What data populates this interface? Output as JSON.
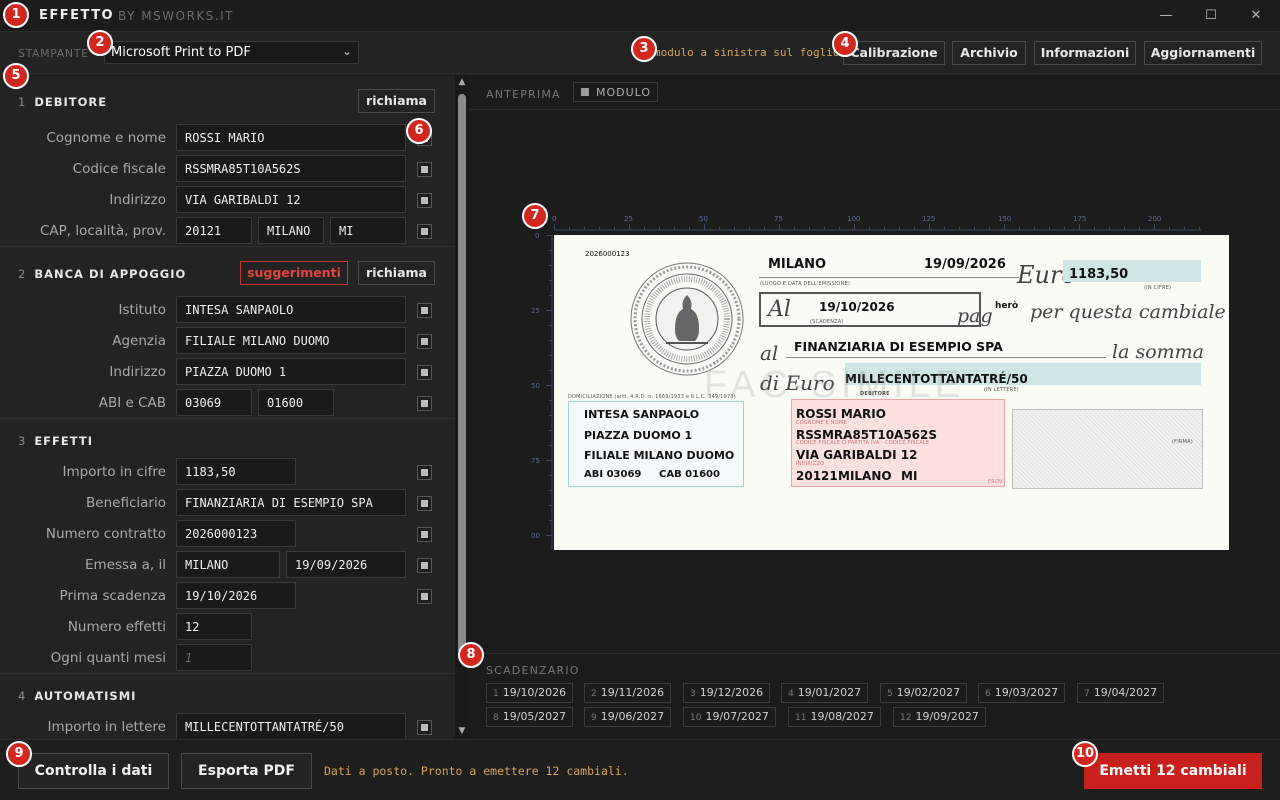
{
  "titlebar": {
    "app_name": "EFFETTO",
    "by_line": "BY MSWORKS.IT",
    "minimize": "—",
    "maximize": "☐",
    "close": "✕"
  },
  "toolbar": {
    "printer_label": "STAMPANTE",
    "printer_value": "Microsoft Print to PDF",
    "modulo_info": "modulo a sinistra sul foglio",
    "buttons": {
      "calibrazione": "Calibrazione",
      "archivio": "Archivio",
      "informazioni": "Informazioni",
      "aggiornamenti": "Aggiornamenti"
    }
  },
  "left": {
    "debitore": {
      "num": "1",
      "title": "DEBITORE",
      "richiama": "richiama",
      "cognome_label": "Cognome e nome",
      "cognome": "ROSSI MARIO",
      "cf_label": "Codice fiscale",
      "cf": "RSSMRA85T10A562S",
      "indirizzo_label": "Indirizzo",
      "indirizzo": "VIA GARIBALDI 12",
      "cap_label": "CAP, località, prov.",
      "cap": "20121",
      "localita": "MILANO",
      "prov": "MI"
    },
    "banca": {
      "num": "2",
      "title": "BANCA DI APPOGGIO",
      "suggerimenti": "suggerimenti",
      "richiama": "richiama",
      "istituto_label": "Istituto",
      "istituto": "INTESA SANPAOLO",
      "agenzia_label": "Agenzia",
      "agenzia": "FILIALE MILANO DUOMO",
      "indirizzo_label": "Indirizzo",
      "indirizzo": "PIAZZA DUOMO 1",
      "abicab_label": "ABI e CAB",
      "abi": "03069",
      "cab": "01600"
    },
    "effetti": {
      "num": "3",
      "title": "EFFETTI",
      "importo_label": "Importo in cifre",
      "importo": "1183,50",
      "beneficiario_label": "Beneficiario",
      "beneficiario": "FINANZIARIA DI ESEMPIO SPA",
      "contratto_label": "Numero contratto",
      "contratto": "2026000123",
      "emessa_label": "Emessa a, il",
      "emessa_luogo": "MILANO",
      "emessa_data": "19/09/2026",
      "scadenza_label": "Prima scadenza",
      "scadenza": "19/10/2026",
      "numero_label": "Numero effetti",
      "numero": "12",
      "mesi_label": "Ogni quanti mesi",
      "mesi_placeholder": "1"
    },
    "automatismi": {
      "num": "4",
      "title": "AUTOMATISMI",
      "lettere_label": "Importo in lettere",
      "lettere": "MILLECENTOTTANTATRÉ/50"
    }
  },
  "preview": {
    "anteprima_label": "ANTEPRIMA",
    "modulo_toggle": "MODULO",
    "ruler_h": [
      "0",
      "25",
      "50",
      "75",
      "100",
      "125",
      "150",
      "175",
      "200"
    ],
    "ruler_v": [
      "0",
      "25",
      "50",
      "75",
      "00"
    ],
    "cheque": {
      "contract": "2026000123",
      "city": "MILANO",
      "issue_date": "19/09/2026",
      "euro_script": "Euro",
      "amount": "1183,50",
      "in_cifre": "(IN CIFRE)",
      "luogo_data": "(LUOGO E DATA DELL'EMISSIONE)",
      "al_script": "Al",
      "due_date": "19/10/2026",
      "scadenza_small": "(SCADENZA)",
      "pag_script": "pag",
      "hero": "herò",
      "per_questa": "per questa cambiale",
      "al2_script": "al",
      "beneficiary": "FINANZIARIA DI ESEMPIO SPA",
      "la_somma": "la somma",
      "di_euro": "di Euro",
      "amount_words": "MILLECENTOTTANTATRÉ/50",
      "in_lettere": "(IN LETTERE)",
      "watermark": "FAC-SIMILE",
      "domic_label": "DOMICILIAZIONE (artt. 4 R.D. n. 1669/1933 e 6 L.C. 349/1973)",
      "bank_name": "INTESA SANPAOLO",
      "bank_addr": "PIAZZA DUOMO 1",
      "bank_branch": "FILIALE MILANO DUOMO",
      "abi_line": "ABI  03069",
      "cab_line": "CAB 01600",
      "debitore_label": "DEBITORE",
      "cognome_small": "COGNOME E NOME",
      "debtor_name": "ROSSI MARIO",
      "cf_small": "CODICE FISCALE O PARTITA IVA - CODICE FISCALE",
      "debtor_cf": "RSSMRA85T10A562S",
      "indirizzo_small": "INDIRIZZO",
      "debtor_addr": "VIA GARIBALDI 12",
      "debtor_cap": "20121",
      "debtor_city": "MILANO",
      "debtor_prov": "MI",
      "prov_small": "PROV.",
      "firma_small": "(FIRMA)"
    },
    "scadenzario_label": "SCADENZARIO",
    "scadenze": [
      {
        "n": "1",
        "date": "19/10/2026"
      },
      {
        "n": "2",
        "date": "19/11/2026"
      },
      {
        "n": "3",
        "date": "19/12/2026"
      },
      {
        "n": "4",
        "date": "19/01/2027"
      },
      {
        "n": "5",
        "date": "19/02/2027"
      },
      {
        "n": "6",
        "date": "19/03/2027"
      },
      {
        "n": "7",
        "date": "19/04/2027"
      },
      {
        "n": "8",
        "date": "19/05/2027"
      },
      {
        "n": "9",
        "date": "19/06/2027"
      },
      {
        "n": "10",
        "date": "19/07/2027"
      },
      {
        "n": "11",
        "date": "19/08/2027"
      },
      {
        "n": "12",
        "date": "19/09/2027"
      }
    ]
  },
  "bottom": {
    "controlla": "Controlla i dati",
    "esporta": "Esporta PDF",
    "status": "Dati a posto. Pronto a emettere 12 cambiali.",
    "emetti": "Emetti 12 cambiali"
  },
  "badges": [
    "1",
    "2",
    "3",
    "4",
    "5",
    "6",
    "7",
    "8",
    "9",
    "10"
  ],
  "colors": {
    "accent_red": "#c8201d",
    "status_amber": "#d8a458",
    "background": "#232323"
  }
}
